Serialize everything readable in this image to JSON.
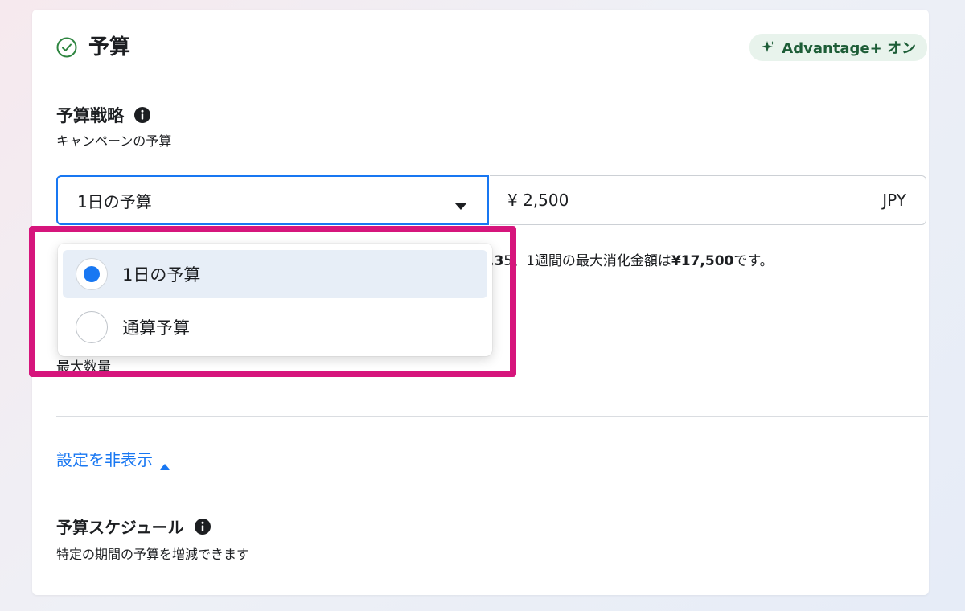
{
  "colors": {
    "accent": "#1877f2",
    "highlight": "#d6157c",
    "badge_bg": "#e8f3ec",
    "badge_text": "#1d5d37"
  },
  "header": {
    "icon": "check-circle-icon",
    "title": "予算",
    "badge": {
      "icon": "sparkle-icon",
      "label": "Advantage+ オン"
    }
  },
  "budget_strategy": {
    "label": "予算戦略",
    "info_icon": "info-icon",
    "subtitle": "キャンペーンの予算",
    "select": {
      "selected_value": "1日の予算",
      "icon": "caret-down-icon"
    },
    "amount": {
      "value": "¥ 2,500",
      "currency": "JPY"
    },
    "helper_prefix": ",3",
    "helper_mid": "5、1週間の最大消化金額は",
    "helper_bold": "¥17,500",
    "helper_suffix": "です。",
    "obscured_label": "最大数量"
  },
  "dropdown": {
    "options": [
      {
        "label": "1日の予算",
        "selected": true
      },
      {
        "label": "通算予算",
        "selected": false
      }
    ]
  },
  "settings_toggle": {
    "label": "設定を非表示",
    "icon": "caret-up-icon"
  },
  "schedule": {
    "label": "予算スケジュール",
    "info_icon": "info-icon",
    "subtitle": "特定の期間の予算を増減できます"
  }
}
